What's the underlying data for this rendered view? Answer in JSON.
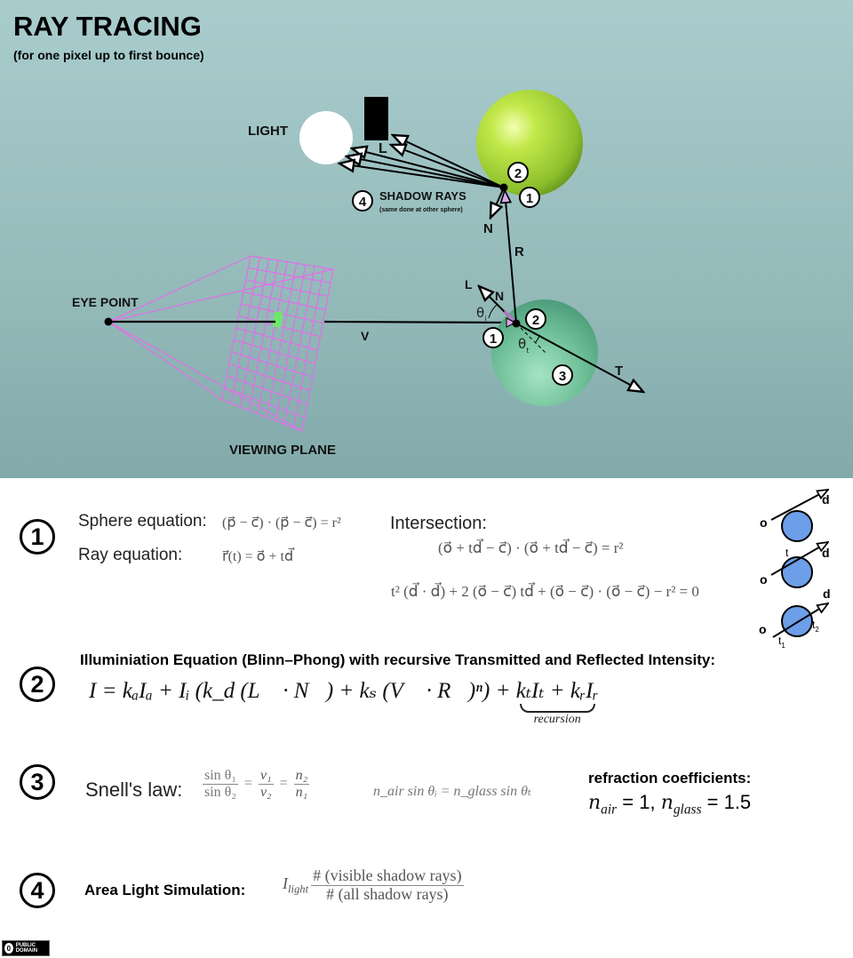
{
  "title": "RAY TRACING",
  "subtitle": "(for one pixel up to first bounce)",
  "diagram": {
    "labels": {
      "light": "LIGHT",
      "eye_point": "EYE POINT",
      "viewing_plane": "VIEWING PLANE",
      "shadow_rays": "SHADOW RAYS",
      "shadow_rays_note": "(same done at other sphere)",
      "vec_L_top": "L",
      "vec_N_top": "N",
      "vec_R": "R",
      "vec_V": "V",
      "vec_L": "L",
      "vec_N": "N",
      "vec_T": "T",
      "theta_i": "θ",
      "theta_i_sub": "i",
      "theta_t": "θ",
      "theta_t_sub": "t"
    },
    "markers": {
      "green_sphere_1": "1",
      "green_sphere_2": "2",
      "shadow_4": "4",
      "glass_sphere_1": "1",
      "glass_sphere_2": "2",
      "glass_sphere_3": "3"
    },
    "colors": {
      "green_sphere": "#a6d63a",
      "glass_sphere": "#6fbf98",
      "grid": "#e070e8",
      "pixel": "#6ee86a",
      "intersection_blue": "#6d9ee8"
    }
  },
  "sections": {
    "s1": {
      "number": "1",
      "sphere_label": "Sphere equation:",
      "sphere_eq": "(p⃗ − c⃗) · (p⃗ − c⃗) = r²",
      "ray_label": "Ray equation:",
      "ray_eq": "r⃗(t) = o⃗ + td⃗",
      "intersection_label": "Intersection:",
      "intersection_eq1": "(o⃗ + td⃗ − c⃗) · (o⃗ + td⃗ − c⃗) = r²",
      "intersection_eq2": "t² (d⃗ · d⃗) + 2 (o⃗ − c⃗) td⃗ + (o⃗ − c⃗) · (o⃗ − c⃗) − r² = 0",
      "cases": {
        "o": "o",
        "d": "d",
        "t": "t",
        "t1": "t",
        "t1_sub": "1",
        "t2": "t",
        "t2_sub": "2"
      }
    },
    "s2": {
      "number": "2",
      "heading": "Illuminiation Equation (Blinn–Phong) with recursive Transmitted and Reflected Intensity:",
      "equation_main": "I = kₐIₐ + Iᵢ (k_d (L⃗ · N⃗) + kₛ (V⃗ · R⃗)ⁿ) + ",
      "equation_recursion": "kₜIₜ + kᵣIᵣ",
      "recursion_label": "recursion"
    },
    "s3": {
      "number": "3",
      "label": "Snell's law:",
      "frac1_num": "sin θ₁",
      "frac1_den": "sin θ₂",
      "frac2_num": "v₁",
      "frac2_den": "v₂",
      "frac3_num": "n₂",
      "frac3_den": "n₁",
      "equation2": "n_air sin θᵢ = n_glass sin θₜ",
      "coeff_heading": "refraction coefficients:",
      "n": "n",
      "air_sub": "air",
      "air_val": " = 1, ",
      "glass_sub": "glass",
      "glass_val": " = 1.5"
    },
    "s4": {
      "number": "4",
      "label": "Area Light Simulation:",
      "prefix": "I",
      "prefix_sub": "light",
      "num": "# (visible shadow rays)",
      "den": "# (all shadow rays)"
    }
  },
  "license": {
    "icon": "0",
    "text": "PUBLIC DOMAIN"
  }
}
